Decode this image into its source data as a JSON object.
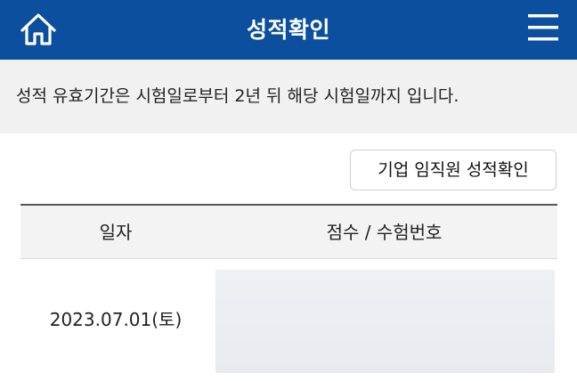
{
  "header": {
    "title": "성적확인"
  },
  "notice": {
    "text": "성적 유효기간은 시험일로부터 2년 뒤 해당 시험일까지 입니다."
  },
  "actions": {
    "confirm_label": "기업 임직원 성적확인"
  },
  "table": {
    "columns": [
      "일자",
      "점수 / 수험번호"
    ],
    "rows": [
      {
        "date": "2023.07.01(토)",
        "score": ""
      }
    ]
  },
  "colors": {
    "header_bg": "#0b4f9e",
    "notice_bg": "#f1f1f1",
    "table_header_bg": "#f3f3f3"
  },
  "icons": {
    "home": "home-icon",
    "menu": "hamburger-menu-icon"
  }
}
